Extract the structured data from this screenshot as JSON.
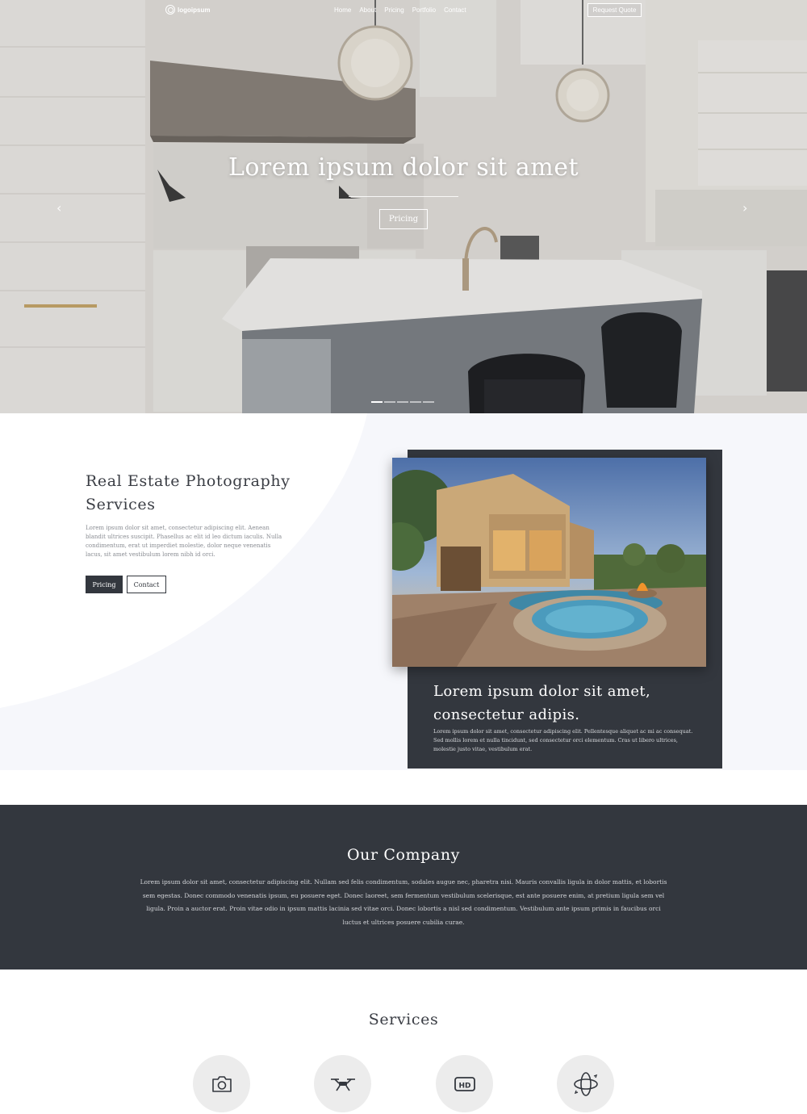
{
  "nav": {
    "logo_text": "logoipsum",
    "links": [
      "Home",
      "About",
      "Pricing",
      "Portfolio",
      "Contact"
    ],
    "quote_label": "Request Quote"
  },
  "hero": {
    "title": "Lorem ipsum dolor sit amet",
    "button_label": "Pricing",
    "prev_icon": "chevron-left-icon",
    "next_icon": "chevron-right-icon",
    "slide_count": 5,
    "active_slide": 1
  },
  "intro": {
    "heading": "Real Estate Photography Services",
    "body": "Lorem ipsum dolor sit amet, consectetur adipiscing elit. Aenean blandit ultrices suscipit. Phasellus ac elit id leo dictum iaculis. Nulla condimentum, erat ut imperdiet molestie, dolor neque venenatis lacus, sit amet vestibulum lorem nibh id orci.",
    "primary_button": "Pricing",
    "secondary_button": "Contact"
  },
  "feature": {
    "title": "Lorem ipsum dolor sit amet, consectetur adipis.",
    "body": "Lorem ipsum dolor sit amet, consectetur adipiscing elit. Pellentesque aliquet ac mi ac consequat. Sed mollis lorem et nulla tincidunt, sed consectetur orci elementum. Cras ut libero ultrices, molestie justo vitae, vestibulum erat."
  },
  "company": {
    "title": "Our Company",
    "body": "Lorem ipsum dolor sit amet, consectetur adipiscing elit. Nullam sed felis condimentum, sodales augue nec, pharetra nisi. Mauris convallis ligula in dolor mattis, et lobortis sem egestas. Donec commodo venenatis ipsum, eu posuere eget. Donec laoreet, sem fermentum vestibulum scelerisque, est ante posuere enim, at pretium ligula sem vel ligula. Proin a auctor erat. Proin vitae odio in ipsum mattis lacinia sed vitae orci. Donec lobortis a nisl sed condimentum. Vestibulum ante ipsum primis in faucibus orci luctus et ultrices posuere cubilia curae."
  },
  "services": {
    "title": "Services",
    "icons": [
      "camera-icon",
      "drone-icon",
      "hd-icon",
      "360-view-icon"
    ]
  },
  "colors": {
    "dark": "#33373e",
    "light_bg": "#f6f7fb",
    "white": "#ffffff",
    "circle": "#ececec"
  }
}
